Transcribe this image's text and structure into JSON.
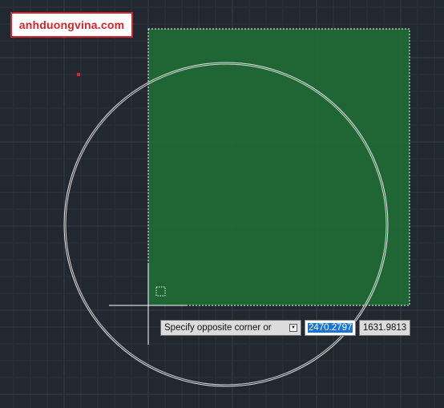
{
  "watermark": {
    "text": "anhduongvina.com"
  },
  "command_prompt": {
    "text": "Specify opposite corner or",
    "options_icon": "down-arrow-icon"
  },
  "dynamic_input": {
    "x_value": "2470.2797",
    "y_value": "1631.9813"
  },
  "colors": {
    "background": "#212830",
    "grid_minor": "#2b333d",
    "grid_major": "#353e49",
    "selection_fill": "#1f6b35",
    "circle_stroke": "#e8e8e8",
    "crosshair": "#ffffff",
    "watermark_red": "#d8232a",
    "input_highlight": "#1a74d6"
  }
}
